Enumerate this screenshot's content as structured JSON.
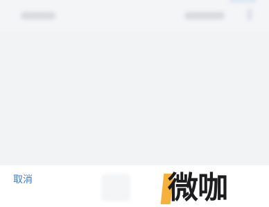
{
  "bottom_bar": {
    "cancel_label": "取消"
  },
  "watermark": {
    "text": "微咖"
  },
  "colors": {
    "link_blue": "#3e7bd0",
    "watermark_orange": "#f6b13a",
    "watermark_text": "#1d1d1f"
  }
}
